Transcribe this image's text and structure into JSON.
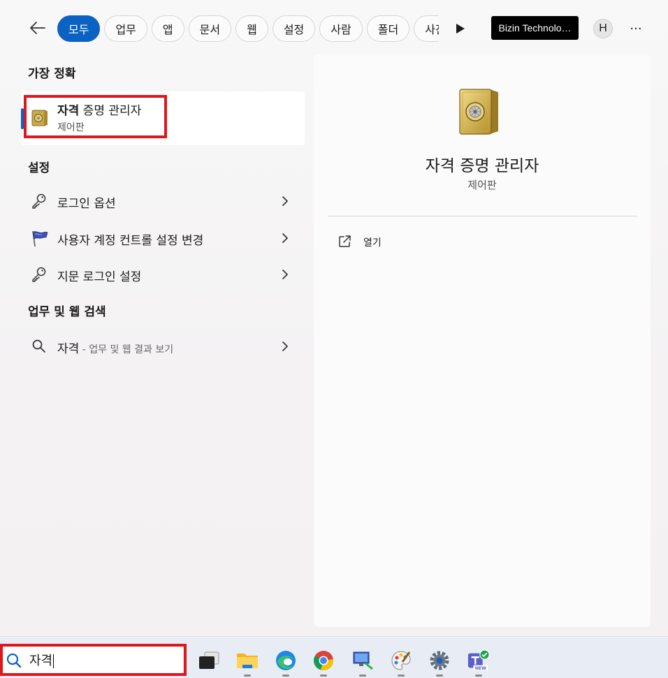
{
  "topbar": {
    "tabs": [
      {
        "label": "모두",
        "active": true
      },
      {
        "label": "업무",
        "active": false
      },
      {
        "label": "앱",
        "active": false
      },
      {
        "label": "문서",
        "active": false
      },
      {
        "label": "웹",
        "active": false
      },
      {
        "label": "설정",
        "active": false
      },
      {
        "label": "사람",
        "active": false
      },
      {
        "label": "폴더",
        "active": false
      },
      {
        "label": "사진",
        "active": false
      }
    ],
    "org_label": "Bizin Technolo…",
    "avatar_initial": "H",
    "more_label": "···"
  },
  "best_match": {
    "heading": "가장 정확",
    "title_bold": "자격",
    "title_rest": " 증명 관리자",
    "subtitle": "제어판"
  },
  "settings": {
    "heading": "설정",
    "items": [
      {
        "label": "로그인 옵션",
        "icon": "key-icon"
      },
      {
        "label": "사용자 계정 컨트롤 설정 변경",
        "icon": "flag-icon"
      },
      {
        "label": "지문 로그인 설정",
        "icon": "key-icon"
      }
    ]
  },
  "web_search": {
    "heading": "업무 및 웹 검색",
    "query": "자격",
    "suffix": " - 업무 및 웹 결과 보기"
  },
  "preview": {
    "title": "자격 증명 관리자",
    "subtitle": "제어판",
    "action_label": "열기"
  },
  "taskbar": {
    "search_text": "자격",
    "apps": [
      "task-view-icon",
      "file-explorer-icon",
      "edge-icon",
      "chrome-icon",
      "remote-desktop-icon",
      "paint-icon",
      "settings-icon",
      "teams-icon"
    ]
  },
  "colors": {
    "accent": "#0a62c2",
    "highlight": "#e0161d"
  }
}
